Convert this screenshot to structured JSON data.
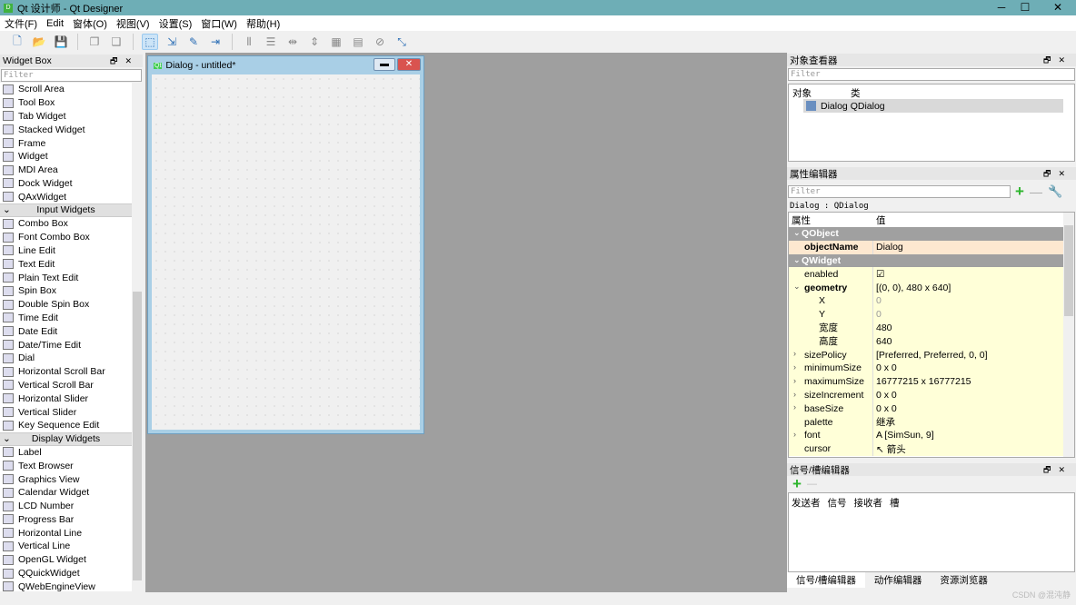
{
  "window": {
    "title": "Qt 设计师 - Qt Designer",
    "logo": "D",
    "controls": [
      "─",
      "☐",
      "✕"
    ]
  },
  "menu": [
    "文件(F)",
    "Edit",
    "窗体(O)",
    "视图(V)",
    "设置(S)",
    "窗口(W)",
    "帮助(H)"
  ],
  "toolbar": {
    "icons": [
      "new-file-icon",
      "open-folder-icon",
      "save-icon",
      "|",
      "bring-front-icon",
      "send-back-icon",
      "|",
      "edit-widgets-icon",
      "edit-signals-icon",
      "edit-buddies-icon",
      "edit-tab-order-icon",
      "|",
      "layout-horizontal-icon",
      "layout-vertical-icon",
      "splitter-horizontal-icon",
      "splitter-vertical-icon",
      "layout-grid-icon",
      "layout-form-icon",
      "break-layout-icon",
      "adjust-size-icon"
    ]
  },
  "widget_box": {
    "title": "Widget Box",
    "filter_placeholder": "Filter",
    "items": [
      {
        "label": "Scroll Area"
      },
      {
        "label": "Tool Box"
      },
      {
        "label": "Tab Widget"
      },
      {
        "label": "Stacked Widget"
      },
      {
        "label": "Frame"
      },
      {
        "label": "Widget"
      },
      {
        "label": "MDI Area"
      },
      {
        "label": "Dock Widget"
      },
      {
        "label": "QAxWidget"
      },
      {
        "category": "Input Widgets"
      },
      {
        "label": "Combo Box"
      },
      {
        "label": "Font Combo Box"
      },
      {
        "label": "Line Edit"
      },
      {
        "label": "Text Edit"
      },
      {
        "label": "Plain Text Edit"
      },
      {
        "label": "Spin Box"
      },
      {
        "label": "Double Spin Box"
      },
      {
        "label": "Time Edit"
      },
      {
        "label": "Date Edit"
      },
      {
        "label": "Date/Time Edit"
      },
      {
        "label": "Dial"
      },
      {
        "label": "Horizontal Scroll Bar"
      },
      {
        "label": "Vertical Scroll Bar"
      },
      {
        "label": "Horizontal Slider"
      },
      {
        "label": "Vertical Slider"
      },
      {
        "label": "Key Sequence Edit"
      },
      {
        "category": "Display Widgets"
      },
      {
        "label": "Label"
      },
      {
        "label": "Text Browser"
      },
      {
        "label": "Graphics View"
      },
      {
        "label": "Calendar Widget"
      },
      {
        "label": "LCD Number"
      },
      {
        "label": "Progress Bar"
      },
      {
        "label": "Horizontal Line"
      },
      {
        "label": "Vertical Line"
      },
      {
        "label": "OpenGL Widget"
      },
      {
        "label": "QQuickWidget"
      },
      {
        "label": "QWebEngineView"
      }
    ]
  },
  "dialog": {
    "title": "Dialog - untitled*",
    "badge": "Qt"
  },
  "object_inspector": {
    "title": "对象查看器",
    "filter_placeholder": "Filter",
    "col_object": "对象",
    "col_class": "类",
    "row_object": "Dialog",
    "row_class": "QDialog"
  },
  "property_editor": {
    "title": "属性编辑器",
    "filter_placeholder": "Filter",
    "context": "Dialog : QDialog",
    "col_prop": "属性",
    "col_value": "值",
    "rows": [
      {
        "cat": "QObject"
      },
      {
        "name": "objectName",
        "value": "Dialog",
        "bold": true,
        "color": "#fde8d0"
      },
      {
        "cat": "QWidget"
      },
      {
        "name": "enabled",
        "value": "☑"
      },
      {
        "name": "geometry",
        "value": "[(0, 0), 480 x 640]",
        "bold": true,
        "expanded": true
      },
      {
        "name": "X",
        "value": "0",
        "sub": true,
        "disabled": true
      },
      {
        "name": "Y",
        "value": "0",
        "sub": true,
        "disabled": true
      },
      {
        "name": "宽度",
        "value": "480",
        "sub": true
      },
      {
        "name": "高度",
        "value": "640",
        "sub": true
      },
      {
        "name": "sizePolicy",
        "value": "[Preferred, Preferred, 0, 0]",
        "collapsed": true
      },
      {
        "name": "minimumSize",
        "value": "0 x 0",
        "collapsed": true
      },
      {
        "name": "maximumSize",
        "value": "16777215 x 16777215",
        "collapsed": true
      },
      {
        "name": "sizeIncrement",
        "value": "0 x 0",
        "collapsed": true
      },
      {
        "name": "baseSize",
        "value": "0 x 0",
        "collapsed": true
      },
      {
        "name": "palette",
        "value": "继承"
      },
      {
        "name": "font",
        "value": "A  [SimSun, 9]",
        "collapsed": true
      },
      {
        "name": "cursor",
        "value": "↖ 箭头"
      }
    ]
  },
  "signal_slot_editor": {
    "title": "信号/槽编辑器",
    "columns": [
      "发送者",
      "信号",
      "接收者",
      "槽"
    ]
  },
  "bottom_tabs": [
    "信号/槽编辑器",
    "动作编辑器",
    "资源浏览器"
  ],
  "watermark": "CSDN @混沌静",
  "colors": {
    "titlebar": "#6eaeb6",
    "category": "#a0a0a0",
    "prop_row": "#ffffd8",
    "objectname_row": "#fde8d0"
  }
}
